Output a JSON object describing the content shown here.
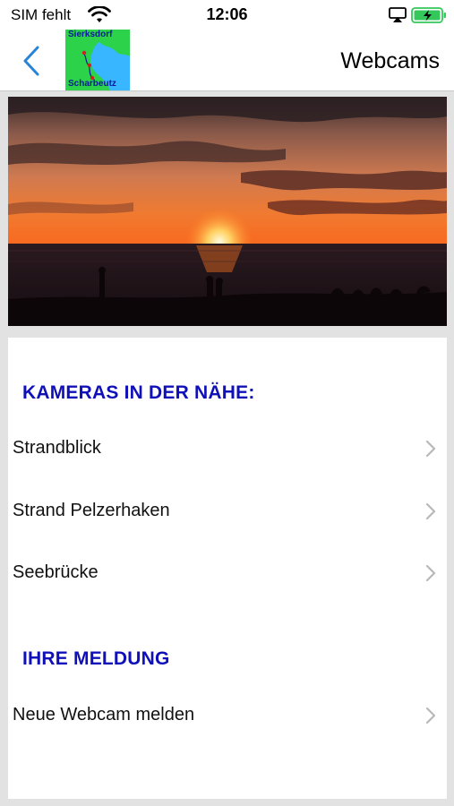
{
  "status_bar": {
    "carrier": "SIM fehlt",
    "time": "12:06"
  },
  "nav": {
    "title": "Webcams",
    "logo_top": "Sierksdorf",
    "logo_bottom": "Scharbeutz"
  },
  "sections": {
    "cameras_header": "KAMERAS IN DER NÄHE:",
    "report_header": "IHRE MELDUNG"
  },
  "cameras": [
    {
      "label": "Strandblick"
    },
    {
      "label": "Strand Pelzerhaken"
    },
    {
      "label": "Seebrücke"
    }
  ],
  "report": {
    "label": "Neue Webcam melden"
  },
  "colors": {
    "accent": "#1010b8",
    "ios_blue": "#2a84d6",
    "battery_green": "#34c759",
    "logo_green": "#2cd24a"
  }
}
